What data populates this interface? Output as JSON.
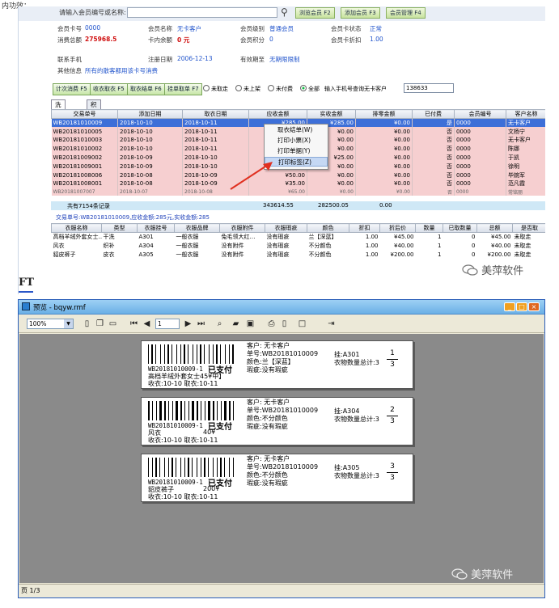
{
  "top_caption": "内功效：",
  "app": {
    "search": {
      "label": "请输入会员编号或名称:",
      "buttons": [
        "浏览会员 F2",
        "添加会员 F3",
        "会员管理 F4"
      ]
    },
    "member": {
      "card_no_label": "会员卡号",
      "card_no": "0000",
      "name_label": "会员名称",
      "name": "无卡客户",
      "level_label": "会员级别",
      "level": "普通会员",
      "card_status_label": "会员卡状态",
      "card_status": "正常",
      "total_spend_label": "消费总额",
      "total_spend": "275968.5",
      "balance_label": "卡内余额",
      "balance": "0 元",
      "points_label": "会员积分",
      "points": "0",
      "discount_label": "会员卡折扣",
      "discount": "1.00",
      "phone_label": "联系手机",
      "reg_date_label": "注册日期",
      "reg_date": "2006-12-13",
      "valid_label": "有效期至",
      "valid": "无期限限制",
      "other_label": "其他信息",
      "other": "所有的散客都用该卡号消费"
    },
    "actions": {
      "btn_count": "计次消费 F5",
      "btn_receive": "收衣取衣 F5",
      "btn_pickup": "取衣结单 F6",
      "btn_hang": "挂单取单 F7",
      "radio_unpicked": "未取走",
      "radio_unlisted": "未上架",
      "radio_unpaid": "未付费",
      "radio_all": "全部",
      "phone_query_label": "输入手机号查询无卡客户",
      "phone_query_value": "138633"
    },
    "tabs": [
      "洗衣管理",
      "积分管理"
    ],
    "orders": {
      "columns": [
        "交易单号",
        "添加日期",
        "取衣日期",
        "应收金额",
        "实收金额",
        "排零金额",
        "已付费",
        "会员编号",
        "客户名称"
      ],
      "rows": [
        [
          "WB20181010009",
          "2018-10-10",
          "2018-10-11",
          "¥285.00",
          "¥285.00",
          "¥0.00",
          "是",
          "0000",
          "无卡客户"
        ],
        [
          "WB20181010005",
          "2018-10-10",
          "2018-10-11",
          "¥0.00",
          "¥0.00",
          "¥0.00",
          "否",
          "0000",
          "文杨宁"
        ],
        [
          "WB20181010003",
          "2018-10-10",
          "2018-10-11",
          "¥0.00",
          "¥0.00",
          "¥0.00",
          "否",
          "0000",
          "无卡客户"
        ],
        [
          "WB20181010002",
          "2018-10-10",
          "2018-10-11",
          "¥0.00",
          "¥0.00",
          "¥0.00",
          "否",
          "0000",
          "陈娜"
        ],
        [
          "WB20181009002",
          "2018-10-09",
          "2018-10-10",
          "¥0.00",
          "¥25.00",
          "¥0.00",
          "否",
          "0000",
          "于凯"
        ],
        [
          "WB20181009001",
          "2018-10-09",
          "2018-10-10",
          "¥25.00",
          "¥0.00",
          "¥0.00",
          "否",
          "0000",
          "徐明"
        ],
        [
          "WB20181008006",
          "2018-10-08",
          "2018-10-09",
          "¥50.00",
          "¥0.00",
          "¥0.00",
          "否",
          "0000",
          "毕婉军"
        ],
        [
          "WB20181008001",
          "2018-10-08",
          "2018-10-09",
          "¥35.00",
          "¥0.00",
          "¥0.00",
          "否",
          "0000",
          "范凡霞"
        ],
        [
          "WB20181007007",
          "2018-10-07",
          "2018-10-08",
          "¥65.00",
          "¥0.00",
          "¥0.00",
          "否",
          "0000",
          "常铭丽"
        ]
      ]
    },
    "totals": {
      "count_text": "共有7154条记录",
      "receivable": "343614.55",
      "received": "282500.05",
      "zero": "0.00"
    },
    "order_line": "交易单号:WB20181010009,应收金额:285元,实收金额:285",
    "items": {
      "columns": [
        "衣服名称",
        "类型",
        "衣服挂号",
        "衣服品牌",
        "衣服附件",
        "衣服瑕疵",
        "颜色",
        "折扣",
        "折后价",
        "数量",
        "已取数量",
        "总额",
        "是否取"
      ],
      "rows": [
        [
          "高档羊绒外套女士…",
          "干洗",
          "A301",
          "一般衣服",
          "兔毛领大红…",
          "没有瑕疵",
          "兰【深蓝】",
          "1.00",
          "¥45.00",
          "1",
          "0",
          "¥45.00",
          "未取走"
        ],
        [
          "风衣",
          "织补",
          "A304",
          "一般衣服",
          "没有附件",
          "没有瑕疵",
          "不分颜色",
          "1.00",
          "¥40.00",
          "1",
          "0",
          "¥40.00",
          "未取走"
        ],
        [
          "貂皮裤子",
          "皮衣",
          "A305",
          "一般衣服",
          "没有附件",
          "没有瑕疵",
          "不分颜色",
          "1.00",
          "¥200.00",
          "1",
          "0",
          "¥200.00",
          "未取走"
        ]
      ]
    },
    "context_menu": [
      "取衣结单(W)",
      "打印小票(X)",
      "打印单据(Y)",
      "打印标签(Z)"
    ],
    "logo_fragment": "FT",
    "watermark": "美萍软件"
  },
  "preview": {
    "title": "预览 - bqyw.rmf",
    "zoom": "100%",
    "page_input": "1",
    "status": "页 1/3",
    "watermark": "美萍软件",
    "labels": [
      {
        "order_no": "WB20181010009-1",
        "paid": "已支付",
        "customer": "客户:   无卡客户",
        "order": "单号:WB20181010009",
        "color": "颜色:兰【深蓝】",
        "defect": "瑕疵:没有瑕疵",
        "item": "高档羊绒外套女士45¥中】",
        "price": "",
        "dates": "收衣:10-10    取衣:10-11",
        "tag": "挂:A301",
        "count_text": "衣物数量总计:3",
        "frac_top": "1",
        "frac_bottom": "3"
      },
      {
        "order_no": "WB20181010009-1",
        "paid": "已支付",
        "customer": "客户:   无卡客户",
        "order": "单号:WB20181010009",
        "color": "颜色:不分颜色",
        "defect": "瑕疵:没有瑕疵",
        "item": "风衣",
        "price": "40¥",
        "dates": "收衣:10-10    取衣:10-11",
        "tag": "挂:A304",
        "count_text": "衣物数量总计:3",
        "frac_top": "2",
        "frac_bottom": "3"
      },
      {
        "order_no": "WB20181010009-1",
        "paid": "已支付",
        "customer": "客户:   无卡客户",
        "order": "单号:WB20181010009",
        "color": "颜色:不分颜色",
        "defect": "瑕疵:没有瑕疵",
        "item": "貂皮裤子",
        "price": "200¥",
        "dates": "收衣:10-10    取衣:10-11",
        "tag": "挂:A305",
        "count_text": "衣物数量总计:3",
        "frac_top": "3",
        "frac_bottom": "3"
      }
    ]
  },
  "colors": {
    "selected_row": "#3d6fd8",
    "pink_row": "#f6cfd0",
    "title_bar": "#6ab0e6",
    "canvas": "#8a8a8a",
    "arrow": "#e03020"
  }
}
